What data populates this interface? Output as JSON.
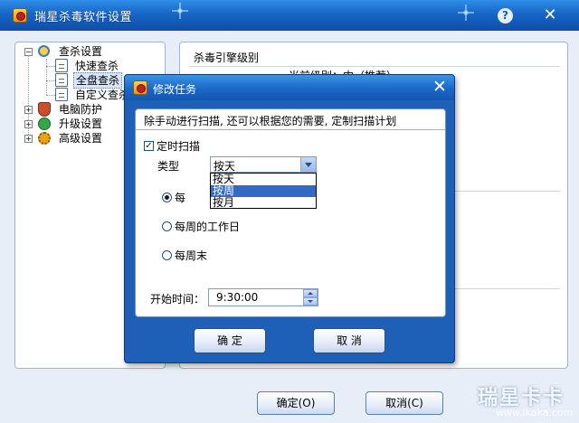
{
  "main_window": {
    "title": "瑞星杀毒软件设置",
    "help_glyph": "?",
    "close_glyph": "✕"
  },
  "tree": {
    "items": [
      {
        "label": "查杀设置",
        "icon": "search-icon",
        "expander": "−"
      },
      {
        "label": "快速查杀",
        "icon": "page-icon"
      },
      {
        "label": "全盘查杀",
        "icon": "page-icon",
        "selected": true
      },
      {
        "label": "自定义查杀",
        "icon": "page-icon"
      },
      {
        "label": "电脑防护",
        "icon": "shield-icon",
        "expander": "+"
      },
      {
        "label": "升级设置",
        "icon": "update-icon",
        "expander": "+"
      },
      {
        "label": "高级设置",
        "icon": "gear-icon",
        "expander": "+"
      }
    ]
  },
  "settings_panel": {
    "engine_level_header": "杀毒引擎级别",
    "current_level_text": "当前级别：中（推荐）"
  },
  "main_buttons": {
    "ok": "确定(O)",
    "cancel": "取消(C)"
  },
  "watermark": {
    "text": "瑞星卡卡",
    "url": "www.ikaka.com"
  },
  "dialog": {
    "title": "修改任务",
    "close_glyph": "✕",
    "description": "除手动进行扫描, 还可以根据您的需要, 定制扫描计划",
    "scheduled_scan": {
      "label": "定时扫描",
      "checked": true
    },
    "type": {
      "label": "类型",
      "selected": "按天",
      "options": [
        "按天",
        "按周",
        "按月"
      ],
      "highlighted_index": 1
    },
    "frequency_options": [
      {
        "label": "每",
        "checked": true
      },
      {
        "label": "每周的工作日",
        "checked": false
      },
      {
        "label": "每周末",
        "checked": false
      }
    ],
    "start_time": {
      "label": "开始时间：",
      "value": "9:30:00"
    },
    "ok_button": "确 定",
    "cancel_button": "取 消"
  },
  "colors": {
    "title_blue": "#1765c6",
    "dropdown_highlight": "#316ac5",
    "window_bg": "#e8eef7"
  }
}
